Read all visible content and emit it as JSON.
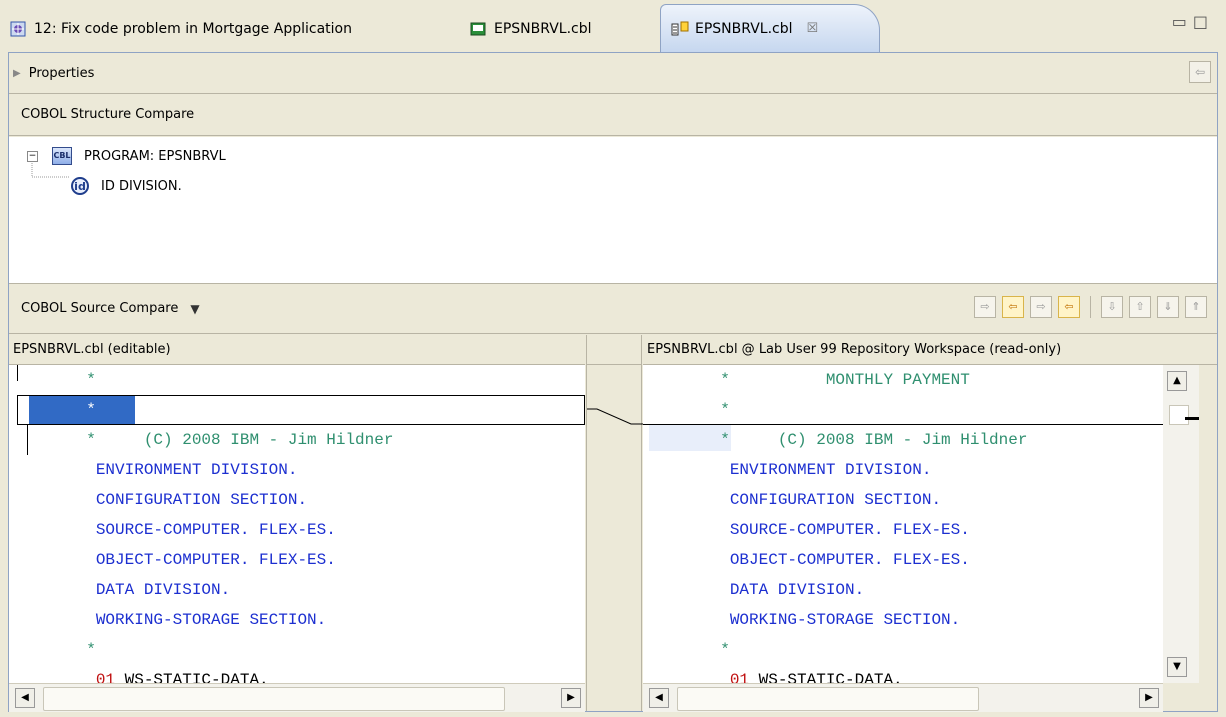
{
  "tabs": [
    {
      "label": "12: Fix code problem in Mortgage Application",
      "icon": "work-item-icon"
    },
    {
      "label": "EPSNBRVL.cbl",
      "icon": "cobol-file-icon"
    },
    {
      "label": "EPSNBRVL.cbl",
      "icon": "compare-icon",
      "active": true,
      "close": "☒"
    }
  ],
  "window_buttons": {
    "minimize": "▭",
    "maximize": "□"
  },
  "properties": {
    "label": "Properties"
  },
  "structure": {
    "header": "COBOL Structure Compare",
    "root": {
      "icon_text": "CBL",
      "label": "PROGRAM: EPSNBRVL"
    },
    "child": {
      "icon_text": "id",
      "label": "ID DIVISION."
    }
  },
  "source": {
    "header": "COBOL Source Compare",
    "left_title": "EPSNBRVL.cbl (editable)",
    "right_title": "EPSNBRVL.cbl @ Lab User 99 Repository Workspace (read-only)"
  },
  "left_lines": [
    {
      "text": "       *",
      "cls": "cmt"
    },
    {
      "text": "       *",
      "cls": "cmt",
      "selected": true
    },
    {
      "text": "       *     (C) 2008 IBM - Jim Hildner",
      "cls": "cmt"
    },
    {
      "text": "        ENVIRONMENT DIVISION.",
      "cls": "kw"
    },
    {
      "text": "        CONFIGURATION SECTION.",
      "cls": "kw"
    },
    {
      "text": "        SOURCE-COMPUTER. FLEX-ES.",
      "cls": "kw"
    },
    {
      "text": "        OBJECT-COMPUTER. FLEX-ES.",
      "cls": "kw"
    },
    {
      "text": "        DATA DIVISION.",
      "cls": "kw"
    },
    {
      "text": "        WORKING-STORAGE SECTION.",
      "cls": "kw"
    },
    {
      "text": "       *",
      "cls": "cmt"
    },
    {
      "text": "        01 WS-STATIC-DATA.",
      "cls": "mixed"
    }
  ],
  "right_lines": [
    {
      "text": "       *          MONTHLY PAYMENT",
      "cls": "cmt"
    },
    {
      "text": "       *",
      "cls": "cmt"
    },
    {
      "text": "       *     (C) 2008 IBM - Jim Hildner",
      "cls": "cmt"
    },
    {
      "text": "        ENVIRONMENT DIVISION.",
      "cls": "kw"
    },
    {
      "text": "        CONFIGURATION SECTION.",
      "cls": "kw"
    },
    {
      "text": "        SOURCE-COMPUTER. FLEX-ES.",
      "cls": "kw"
    },
    {
      "text": "        OBJECT-COMPUTER. FLEX-ES.",
      "cls": "kw"
    },
    {
      "text": "        DATA DIVISION.",
      "cls": "kw"
    },
    {
      "text": "        WORKING-STORAGE SECTION.",
      "cls": "kw"
    },
    {
      "text": "       *",
      "cls": "cmt"
    },
    {
      "text": "        01 WS-STATIC-DATA.",
      "cls": "mixed"
    }
  ],
  "colors": {
    "comment": "#2f8f6f",
    "keyword": "#1c2fd0",
    "level_number": "#c01010",
    "selection": "#316ac5"
  }
}
